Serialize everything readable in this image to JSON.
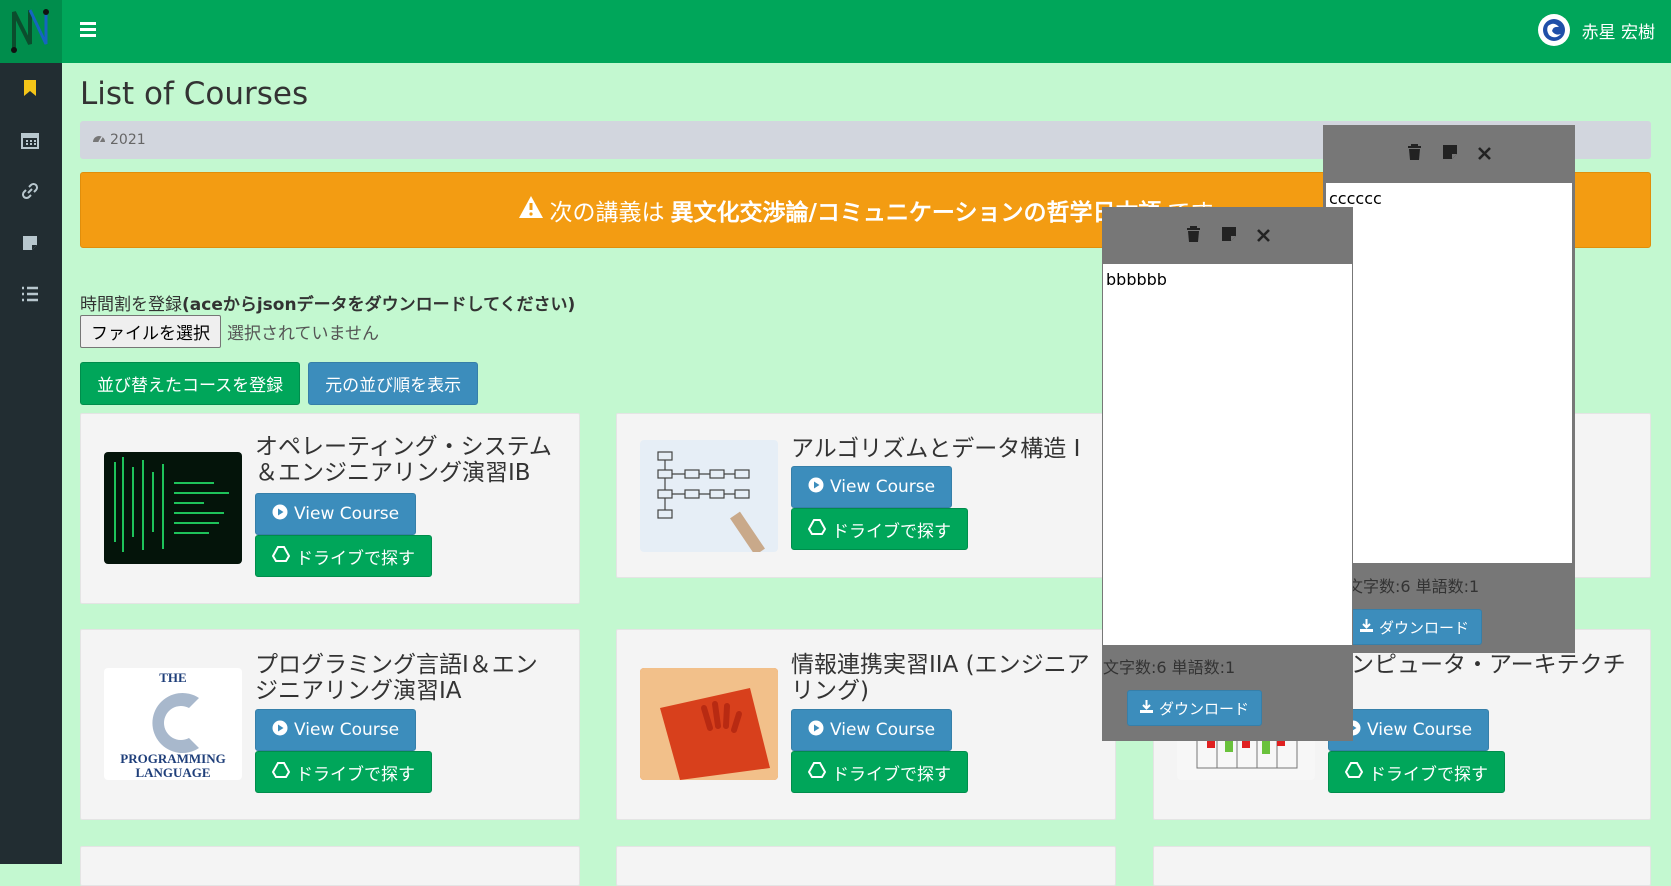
{
  "header": {
    "user_name": "赤星 宏樹"
  },
  "sidebar": {
    "items": [
      "bookmark-icon",
      "calendar-icon",
      "link-icon",
      "note-icon",
      "list-icon"
    ]
  },
  "page": {
    "title": "List of Courses",
    "breadcrumb": "2021",
    "alert": {
      "prefix": "次の講義は",
      "course": "異文化交渉論/コミュニケーションの哲学日本語",
      "suffix": "です"
    },
    "register_label": "時間割を登録",
    "register_hint": "(aceからjsonデータをダウンロードしてください)",
    "file_button": "ファイルを選択",
    "file_status": "選択されていません",
    "sorted_button": "並び替えたコースを登録",
    "original_button": "元の並び順を表示"
  },
  "courses": [
    {
      "title": "オペレーティング・システム＆エンジニアリング演習IB",
      "view": "View Course",
      "drive": "ドライブで探す"
    },
    {
      "title": "アルゴリズムとデータ構造 I",
      "view": "View Course",
      "drive": "ドライブで探す"
    },
    {
      "title": "プログラミング言語I＆エンジニアリング演習IA",
      "view": "View Course",
      "drive": "ドライブで探す"
    },
    {
      "title": "情報連携実習IIA (エンジニアリング)",
      "view": "View Course",
      "drive": "ドライブで探す"
    },
    {
      "title": "コンピュータ・アーキテクチ",
      "view": "View Course",
      "drive": "ドライブで探す"
    }
  ],
  "notes": [
    {
      "text": "cccccc",
      "count": "文字数:6 単語数:1",
      "download": "ダウンロード"
    },
    {
      "text": "bbbbbb",
      "count": "文字数:6 単語数:1",
      "download": "ダウンロード"
    }
  ],
  "colors": {
    "header": "#00a65a",
    "sidebar": "#222d32",
    "background": "#c3f8d0",
    "alert": "#f39c12",
    "primary": "#3c8dbc",
    "success": "#00a65a",
    "note": "#777777"
  }
}
